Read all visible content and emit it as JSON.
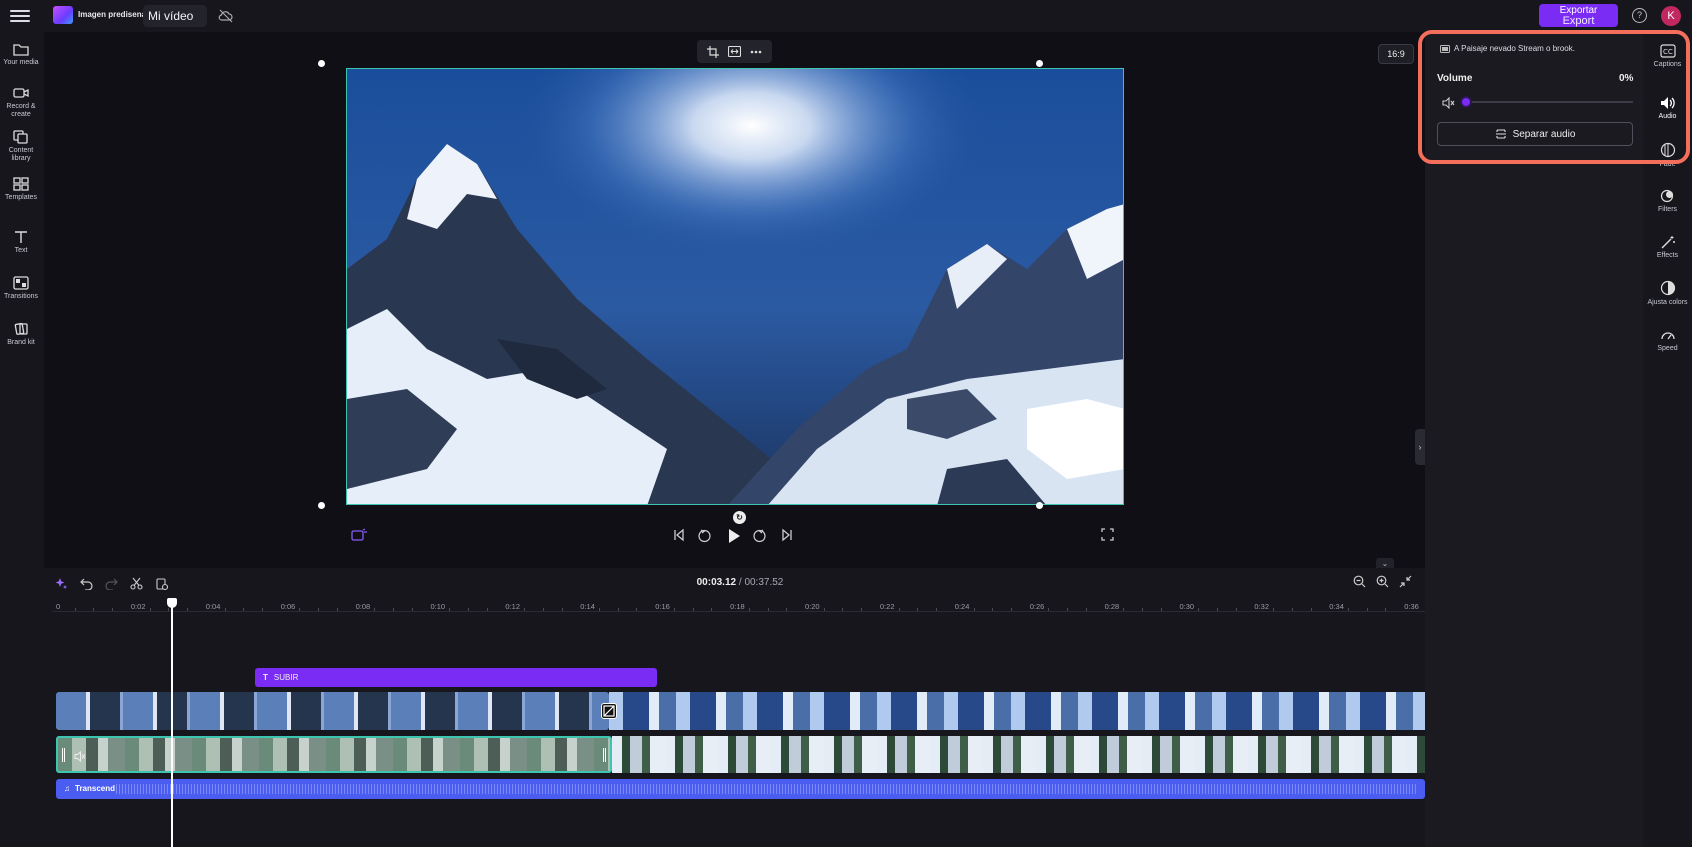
{
  "header": {
    "brand_text": "Imagen predisenada",
    "project_name": "Mi vídeo",
    "export_top": "Exportar",
    "export_bottom": "Export",
    "help": "?",
    "avatar_initial": "K"
  },
  "left_sidebar": {
    "items": [
      {
        "label": "Your media",
        "icon": "folder-icon"
      },
      {
        "label": "Record & create",
        "icon": "camera-icon"
      },
      {
        "label": "Content library",
        "icon": "library-icon"
      },
      {
        "label": "Templates",
        "icon": "templates-icon"
      },
      {
        "label": "Text",
        "icon": "text-icon"
      },
      {
        "label": "Transitions",
        "icon": "transitions-icon"
      },
      {
        "label": "Brand kit",
        "icon": "brand-kit-icon"
      }
    ]
  },
  "preview": {
    "aspect_ratio": "16:9",
    "selection_color": "#3ec5b0"
  },
  "audio_panel": {
    "clip_name": "A Paisaje nevado Stream o brook.",
    "volume_label": "Volume",
    "volume_value": "0%",
    "volume_level": 0,
    "separate_audio_label": "Separar audio",
    "highlight_color": "#f46e5c"
  },
  "right_strip": {
    "items": [
      {
        "label": "Captions",
        "icon": "captions-icon"
      },
      {
        "label": "Audio",
        "icon": "speaker-icon"
      },
      {
        "label": "Fade",
        "icon": "fade-icon"
      },
      {
        "label": "Filters",
        "icon": "filters-icon"
      },
      {
        "label": "Effects",
        "icon": "effects-icon"
      },
      {
        "label": "Ajusta colors",
        "icon": "color-adjust-icon"
      },
      {
        "label": "Speed",
        "icon": "speed-icon"
      }
    ]
  },
  "timeline": {
    "current_time": "00:03.12",
    "separator": " / ",
    "total_time": "00:37.52",
    "ruler_labels": [
      "0",
      "0:02",
      "0:04",
      "0:06",
      "0:08",
      "0:10",
      "0:12",
      "0:14",
      "0:16",
      "0:18",
      "0:20",
      "0:22",
      "0:24",
      "0:26",
      "0:28",
      "0:30",
      "0:32",
      "0:34",
      "0:36"
    ],
    "text_clip_label": "SUBIR",
    "audio_clip_label": "Transcend",
    "accent_color": "#7a2cf5",
    "audio_color": "#4a5df0"
  }
}
